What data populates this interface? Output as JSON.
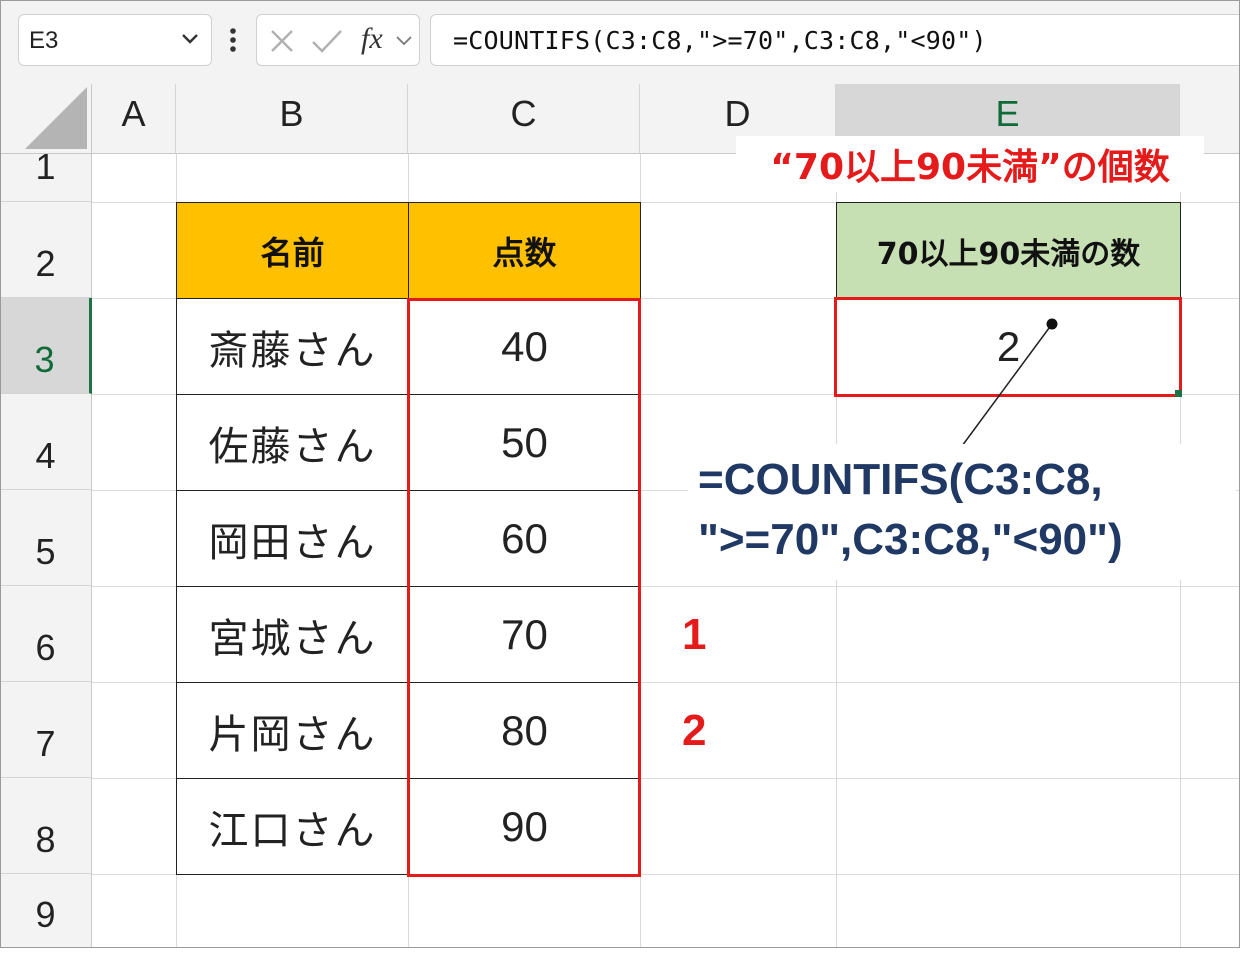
{
  "formula_bar": {
    "name_box": "E3",
    "fx_label": "fx",
    "formula": "=COUNTIFS(C3:C8,\">=70\",C3:C8,\"<90\")"
  },
  "columns": [
    "A",
    "B",
    "C",
    "D",
    "E"
  ],
  "rows": [
    "1",
    "2",
    "3",
    "4",
    "5",
    "6",
    "7",
    "8",
    "9"
  ],
  "table": {
    "header_name": "名前",
    "header_score": "点数",
    "rows": [
      {
        "name": "斎藤さん",
        "score": "40"
      },
      {
        "name": "佐藤さん",
        "score": "50"
      },
      {
        "name": "岡田さん",
        "score": "60"
      },
      {
        "name": "宮城さん",
        "score": "70"
      },
      {
        "name": "片岡さん",
        "score": "80"
      },
      {
        "name": "江口さん",
        "score": "90"
      }
    ]
  },
  "result": {
    "header": "70以上90未満の数",
    "value": "2"
  },
  "annotations": {
    "title": "“70以上90未満”の個数",
    "formula_line1": "=COUNTIFS(C3:C8,",
    "formula_line2": "\">=70\",C3:C8,\"<90\")",
    "marker1": "1",
    "marker2": "2"
  },
  "colors": {
    "table_header": "#ffc000",
    "result_header": "#c6e0b4",
    "highlight": "#e51a1a",
    "formula_text": "#1f3864",
    "selected_header": "#1e7145"
  }
}
